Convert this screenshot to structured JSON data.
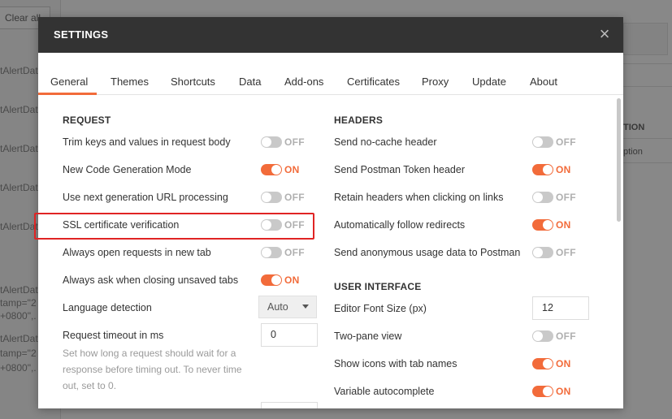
{
  "background": {
    "clear_all": "Clear all",
    "items": [
      "tAlertDat",
      "tAlertDat",
      "tAlertDat",
      "tAlertDat",
      "tAlertDat",
      "tAlertDat",
      "tamp=\"2",
      "+0800\",.",
      "tAlertDat",
      "tamp=\"2",
      "+0800\",."
    ],
    "right_header": "TION",
    "right_text": "ption"
  },
  "modal": {
    "title": "SETTINGS",
    "close": "×"
  },
  "tabs": [
    {
      "label": "General",
      "active": true
    },
    {
      "label": "Themes"
    },
    {
      "label": "Shortcuts"
    },
    {
      "label": "Data"
    },
    {
      "label": "Add-ons"
    },
    {
      "label": "Certificates"
    },
    {
      "label": "Proxy"
    },
    {
      "label": "Update"
    },
    {
      "label": "About"
    }
  ],
  "request": {
    "title": "REQUEST",
    "rows": [
      {
        "label": "Trim keys and values in request body",
        "state": "OFF"
      },
      {
        "label": "New Code Generation Mode",
        "state": "ON"
      },
      {
        "label": "Use next generation URL processing",
        "state": "OFF"
      },
      {
        "label": "SSL certificate verification",
        "state": "OFF"
      },
      {
        "label": "Always open requests in new tab",
        "state": "OFF"
      },
      {
        "label": "Always ask when closing unsaved tabs",
        "state": "ON"
      }
    ],
    "language_detection": {
      "label": "Language detection",
      "value": "Auto"
    },
    "timeout": {
      "label": "Request timeout in ms",
      "value": "0",
      "help": "Set how long a request should wait for a response before timing out. To never time out, set to 0."
    }
  },
  "headers": {
    "title": "HEADERS",
    "rows": [
      {
        "label": "Send no-cache header",
        "state": "OFF"
      },
      {
        "label": "Send Postman Token header",
        "state": "ON"
      },
      {
        "label": "Retain headers when clicking on links",
        "state": "OFF"
      },
      {
        "label": "Automatically follow redirects",
        "state": "ON"
      },
      {
        "label": "Send anonymous usage data to Postman",
        "state": "OFF"
      }
    ]
  },
  "user_interface": {
    "title": "USER INTERFACE",
    "font_size": {
      "label": "Editor Font Size (px)",
      "value": "12"
    },
    "rows": [
      {
        "label": "Two-pane view",
        "state": "OFF"
      },
      {
        "label": "Show icons with tab names",
        "state": "ON"
      },
      {
        "label": "Variable autocomplete",
        "state": "ON"
      }
    ]
  },
  "colors": {
    "accent": "#f26b3a",
    "header": "#333333",
    "highlight": "#e02424"
  }
}
